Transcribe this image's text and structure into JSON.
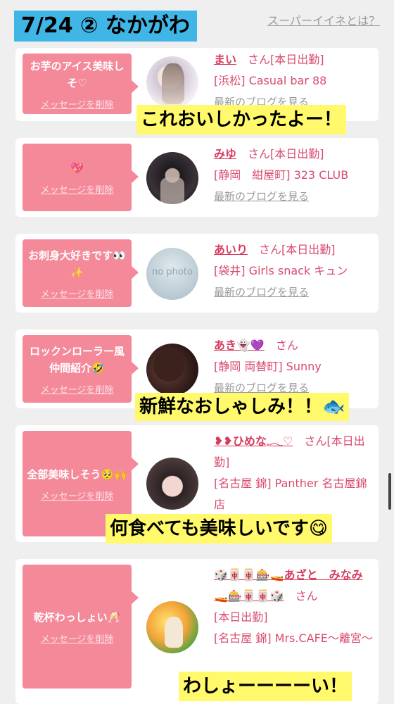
{
  "header": {
    "title": "7/24 ② なかがわ",
    "super_link": "スーパーイイネとは？"
  },
  "cards": [
    {
      "message": "お芋のアイス美味しそ♡",
      "delete": "メッセージを削除",
      "name": "まい",
      "san": "さん",
      "status": "[本日出勤]",
      "shop": "[浜松] Casual bar 88",
      "blog": "最新のブログを見る",
      "caption": "これおいしかったよー！"
    },
    {
      "message": "💖",
      "delete": "メッセージを削除",
      "name": "みゆ",
      "san": "さん",
      "status": "[本日出勤]",
      "shop": "[静岡　紺屋町] 323 CLUB",
      "blog": "最新のブログを見る"
    },
    {
      "message": "お刺身大好きです👀✨",
      "delete": "メッセージを削除",
      "name": "あいり",
      "san": "さん",
      "status": "[本日出勤]",
      "shop": "[袋井] Girls snack キュン",
      "blog": "最新のブログを見る",
      "avatar_text": "no photo"
    },
    {
      "message": "ロックンローラー風仲間紹介🤣",
      "delete": "メッセージを削除",
      "name": "あき👻💜",
      "san": "さん",
      "status": "",
      "shop": "[静岡 両替町] Sunny",
      "blog": "最新のブログを見る",
      "caption": "新鮮なおしゃしみ！！🐟"
    },
    {
      "message": "全部美味しそう🥺🙌",
      "delete": "メッセージを削除",
      "name": "❥❥ひめな𓈒𓂃♡",
      "san": "さん",
      "status": "[本日出勤]",
      "shop": "[名古屋 錦] Panther 名古屋錦店",
      "caption": "何食べても美味しいです😋"
    },
    {
      "message": "乾杯わっしょい🥂",
      "delete": "メッセージを削除",
      "name": "🎲🀄🀄🎰🚤あざと　みなみ🚤🎰🀄🀄🎲",
      "san": "さん",
      "status": "[本日出勤]",
      "shop": "[名古屋 錦] Mrs.CAFE〜離宮〜",
      "caption": "わしょーーーーい！"
    }
  ],
  "colors": {
    "title_bg": "#40b6e6",
    "bubble": "#f4899a",
    "name": "#d83a5e",
    "caption_bg": "#fff96b"
  }
}
